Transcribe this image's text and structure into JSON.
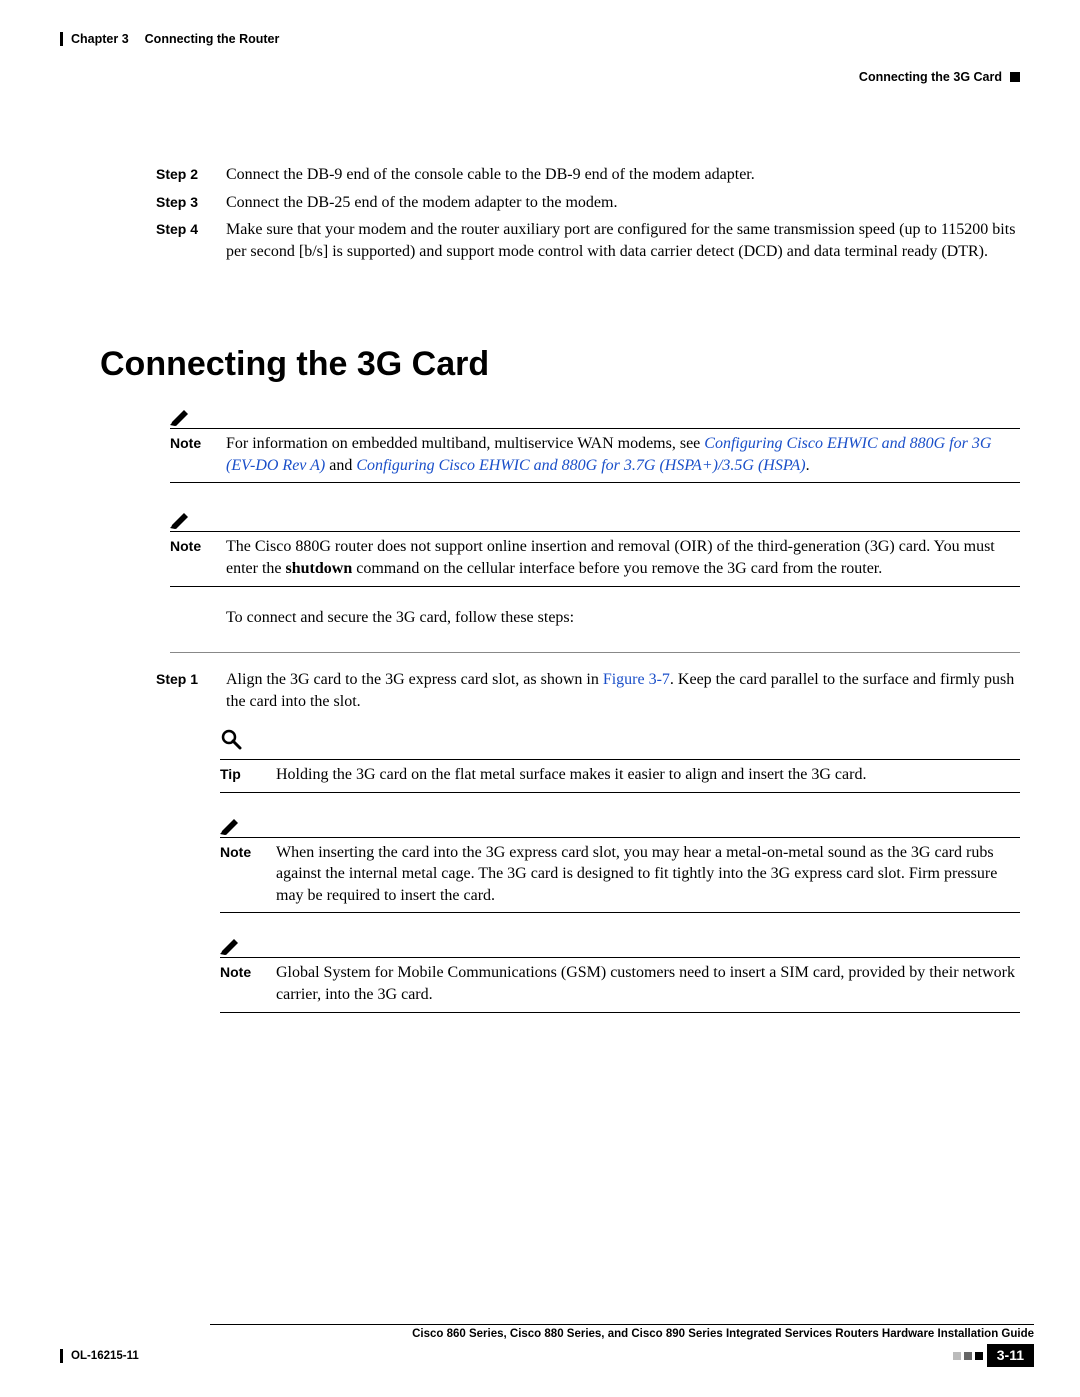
{
  "header": {
    "chapter_label": "Chapter 3",
    "chapter_title": "Connecting the Router",
    "section_title_right": "Connecting the 3G Card"
  },
  "steps_top": [
    {
      "label": "Step 2",
      "text": "Connect the DB-9 end of the console cable to the DB-9 end of the modem adapter."
    },
    {
      "label": "Step 3",
      "text": "Connect the DB-25 end of the modem adapter to the modem."
    },
    {
      "label": "Step 4",
      "text": "Make sure that your modem and the router auxiliary port are configured for the same transmission speed (up to 115200 bits per second [b/s] is supported) and support mode control with data carrier detect (DCD) and data terminal ready (DTR)."
    }
  ],
  "main": {
    "title": "Connecting the 3G Card",
    "note1": {
      "label": "Note",
      "pre": "For information on embedded multiband, multiservice WAN modems, see ",
      "link1": "Configuring Cisco EHWIC and 880G for 3G (EV-DO Rev A)",
      "mid": " and ",
      "link2": "Configuring Cisco EHWIC and 880G for 3.7G (HSPA+)/3.5G (HSPA)",
      "post": "."
    },
    "note2": {
      "label": "Note",
      "pre": "The Cisco 880G router does not support online insertion and removal (OIR) of the third-generation (3G) card. You must enter the ",
      "bold": "shutdown",
      "post": " command on the cellular interface before you remove the 3G card from the router."
    },
    "intro_para": "To connect and secure the 3G card, follow these steps:",
    "step1": {
      "label": "Step 1",
      "pre": "Align the 3G card to the 3G express card slot, as shown in ",
      "ref": "Figure 3-7",
      "post": ". Keep the card parallel to the surface and firmly push the card into the slot."
    },
    "tip": {
      "label": "Tip",
      "text": "Holding the 3G card on the flat metal surface makes it easier to align and insert the 3G card."
    },
    "note3": {
      "label": "Note",
      "text": "When inserting the card into the 3G express card slot, you may hear a metal-on-metal sound as the 3G card rubs against the internal metal cage. The 3G card is designed to fit tightly into the 3G express card slot. Firm pressure may be required to insert the card."
    },
    "note4": {
      "label": "Note",
      "text": "Global System for Mobile Communications (GSM) customers need to insert a SIM card, provided by their network carrier, into the 3G card."
    }
  },
  "footer": {
    "guide_title": "Cisco 860 Series, Cisco 880 Series, and Cisco 890 Series Integrated Services Routers Hardware Installation Guide",
    "doc_id": "OL-16215-11",
    "page": "3-11"
  }
}
